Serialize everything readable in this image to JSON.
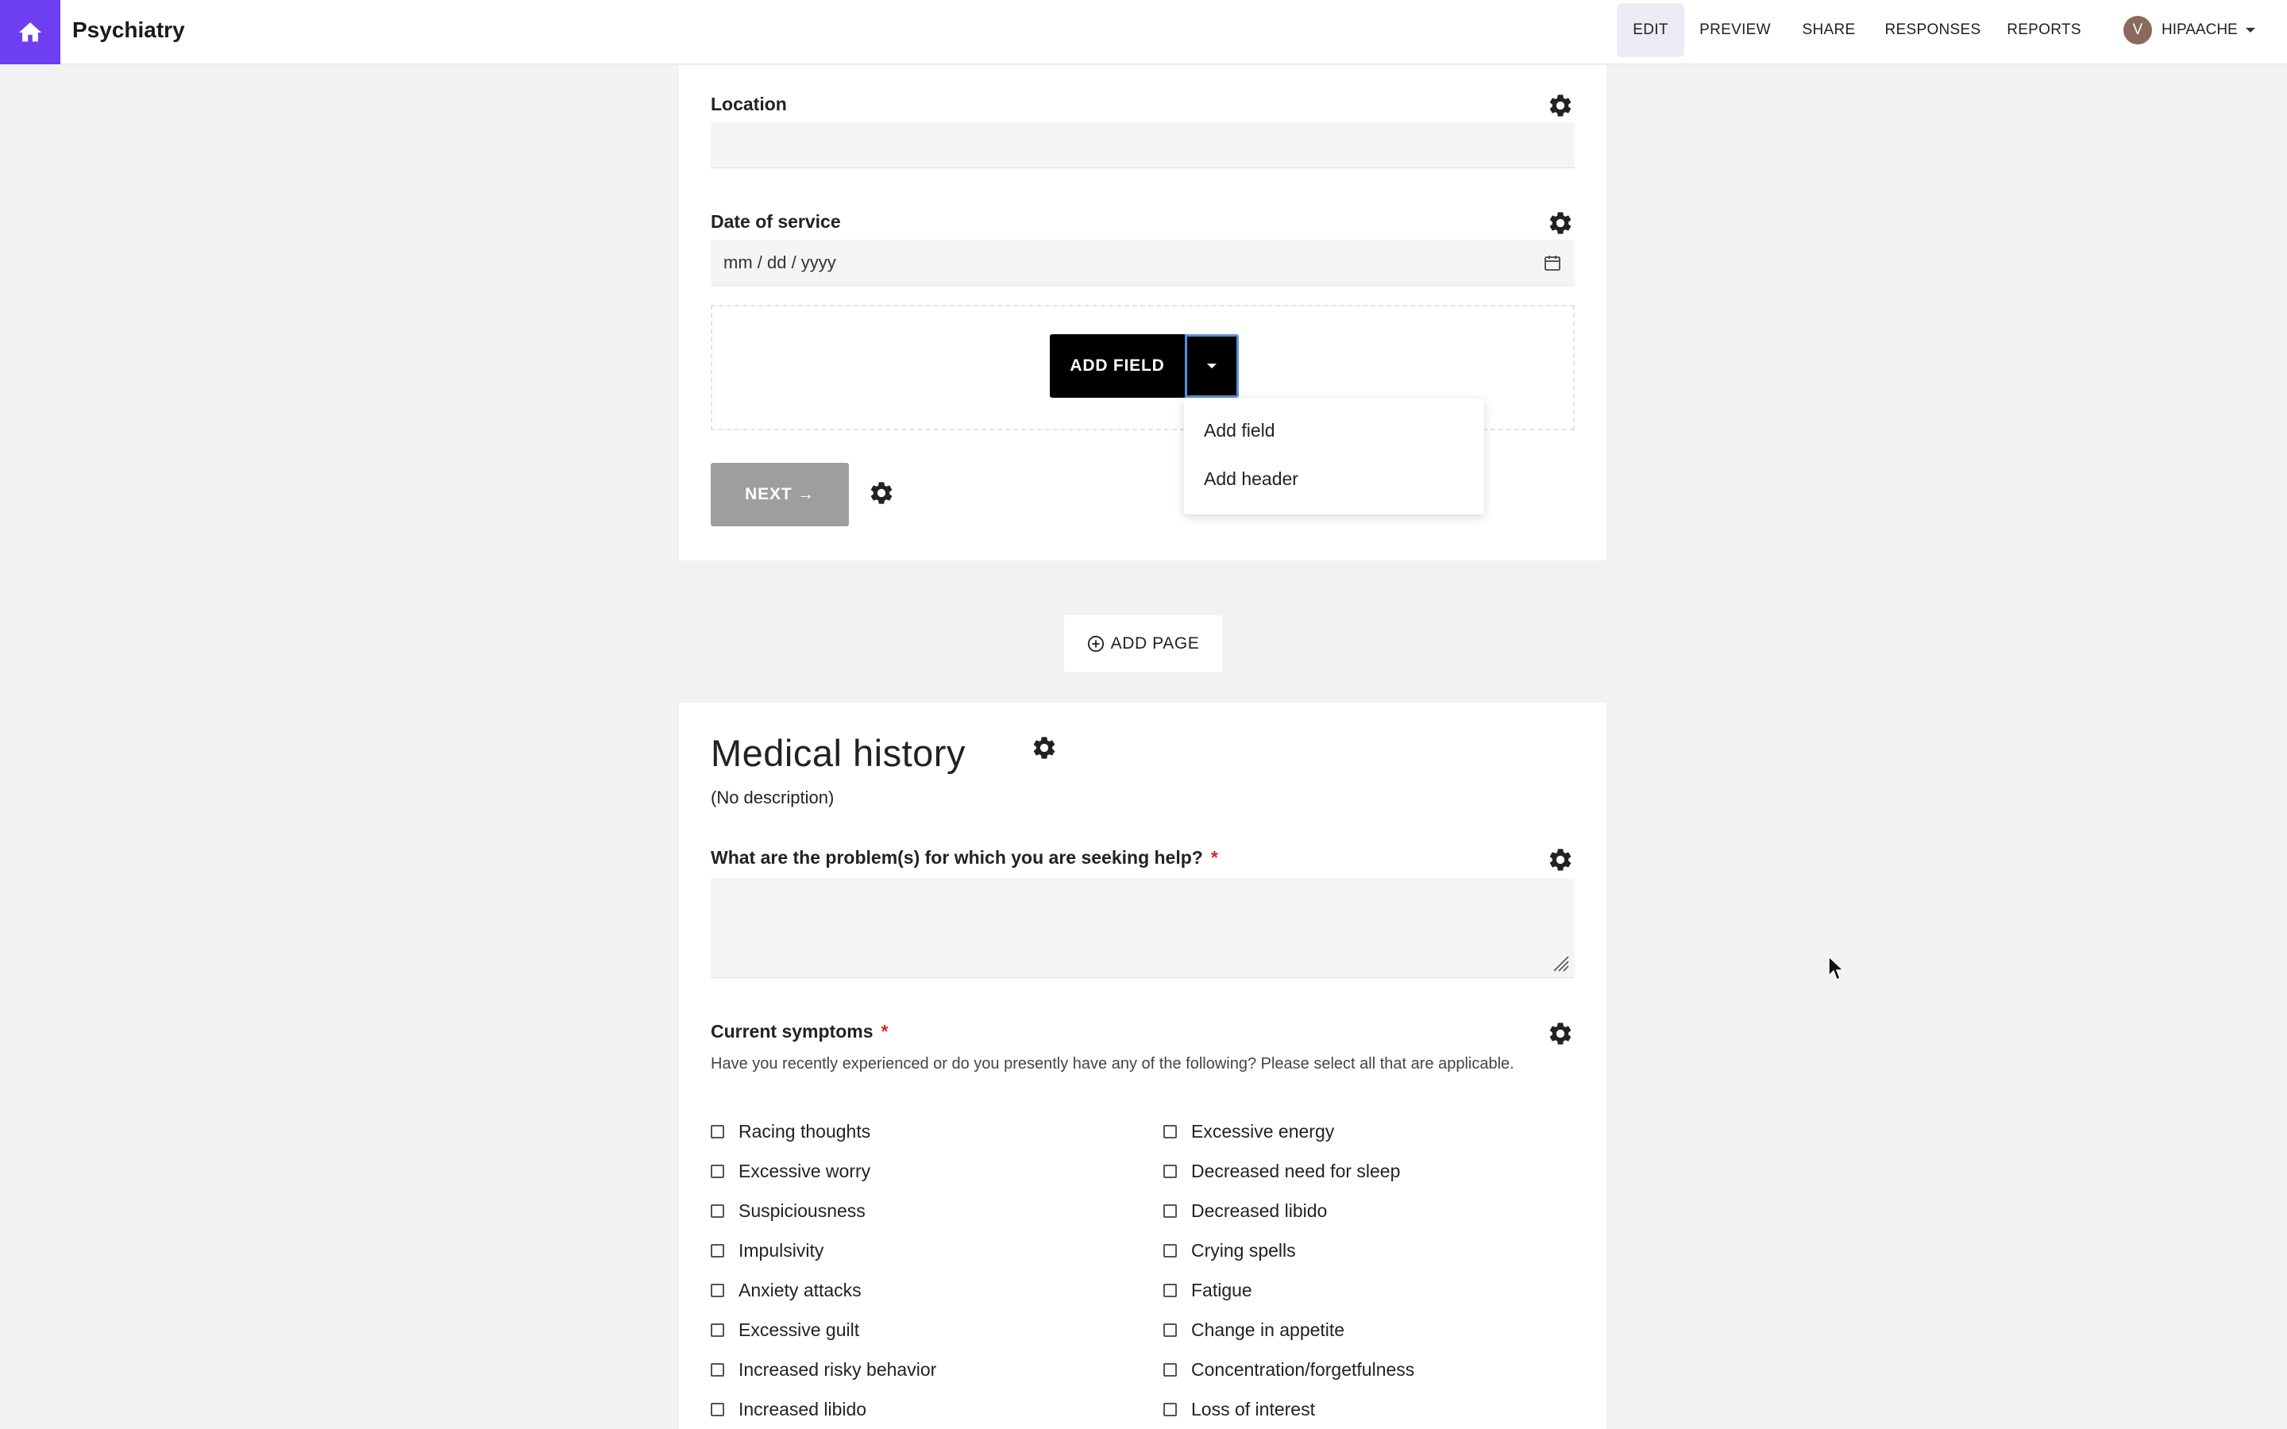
{
  "app": {
    "title": "Psychiatry"
  },
  "nav": {
    "tabs": [
      {
        "label": "EDIT",
        "active": true
      },
      {
        "label": "PREVIEW",
        "active": false
      },
      {
        "label": "SHARE",
        "active": false
      },
      {
        "label": "RESPONSES",
        "active": false
      },
      {
        "label": "REPORTS",
        "active": false
      }
    ],
    "user": {
      "initial": "V",
      "name": "HIPAACHE"
    }
  },
  "page1": {
    "fields": [
      {
        "label": "Location",
        "value": ""
      },
      {
        "label": "Date of service",
        "placeholder": "mm / dd / yyyy"
      }
    ],
    "add_field_label": "ADD FIELD",
    "next_label": "NEXT →",
    "dropdown_items": [
      "Add field",
      "Add header"
    ]
  },
  "add_page_label": "ADD PAGE",
  "page2": {
    "title": "Medical history",
    "description": "(No description)",
    "question1": {
      "label": "What are the problem(s) for which you are seeking help?",
      "required_mark": "*"
    },
    "question2": {
      "label": "Current symptoms",
      "required_mark": "*",
      "description": "Have you recently experienced or do you presently have any of the following? Please select all that are applicable.",
      "options_left": [
        "Racing thoughts",
        "Excessive worry",
        "Suspiciousness",
        "Impulsivity",
        "Anxiety attacks",
        "Excessive guilt",
        "Increased risky behavior",
        "Increased libido"
      ],
      "options_right": [
        "Excessive energy",
        "Decreased need for sleep",
        "Decreased libido",
        "Crying spells",
        "Fatigue",
        "Change in appetite",
        "Concentration/forgetfulness",
        "Loss of interest"
      ]
    }
  },
  "colors": {
    "brand": "#6d3ff0",
    "required": "#e02424",
    "focus": "#5b8fd6"
  }
}
